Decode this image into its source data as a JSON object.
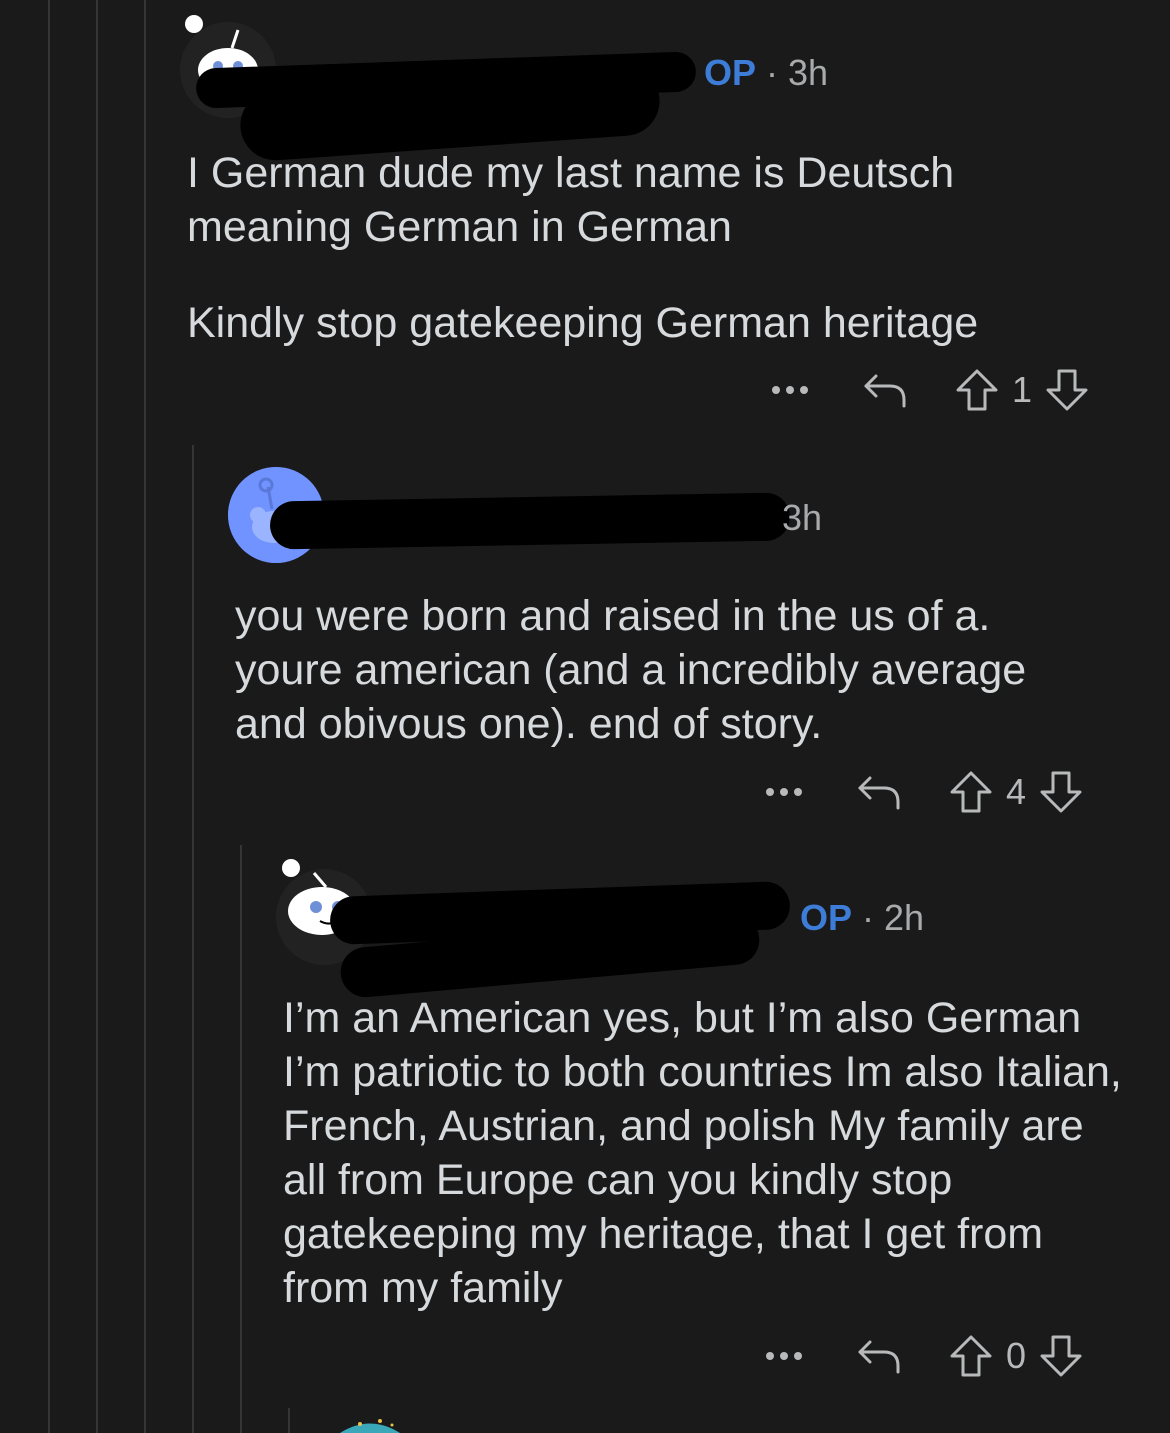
{
  "comments": [
    {
      "op_badge": "OP",
      "time": "3h",
      "paragraphs": [
        "I German dude my last name is Deutsch meaning German in German",
        "Kindly stop gatekeeping German heritage"
      ],
      "score": "1"
    },
    {
      "time": "3h",
      "paragraphs": [
        "you were born and raised in the us of a. youre american (and a incredibly average and obivous one). end of story."
      ],
      "score": "4"
    },
    {
      "op_badge": "OP",
      "time": "2h",
      "paragraphs": [
        "I’m an American yes, but I’m also German I’m patriotic to both countries Im also Italian, French, Austrian, and polish My family are all from Europe can you kindly stop gatekeeping my heritage, that I get from from my family"
      ],
      "score": "0"
    }
  ],
  "icons": [
    "more-icon",
    "reply-icon",
    "upvote-icon",
    "downvote-icon"
  ],
  "colors": {
    "background": "#1a1a1b",
    "op": "#3d7dd8",
    "text": "#d7dadc",
    "meta": "#a8aaab",
    "avatar_blue": "#7193ff"
  }
}
